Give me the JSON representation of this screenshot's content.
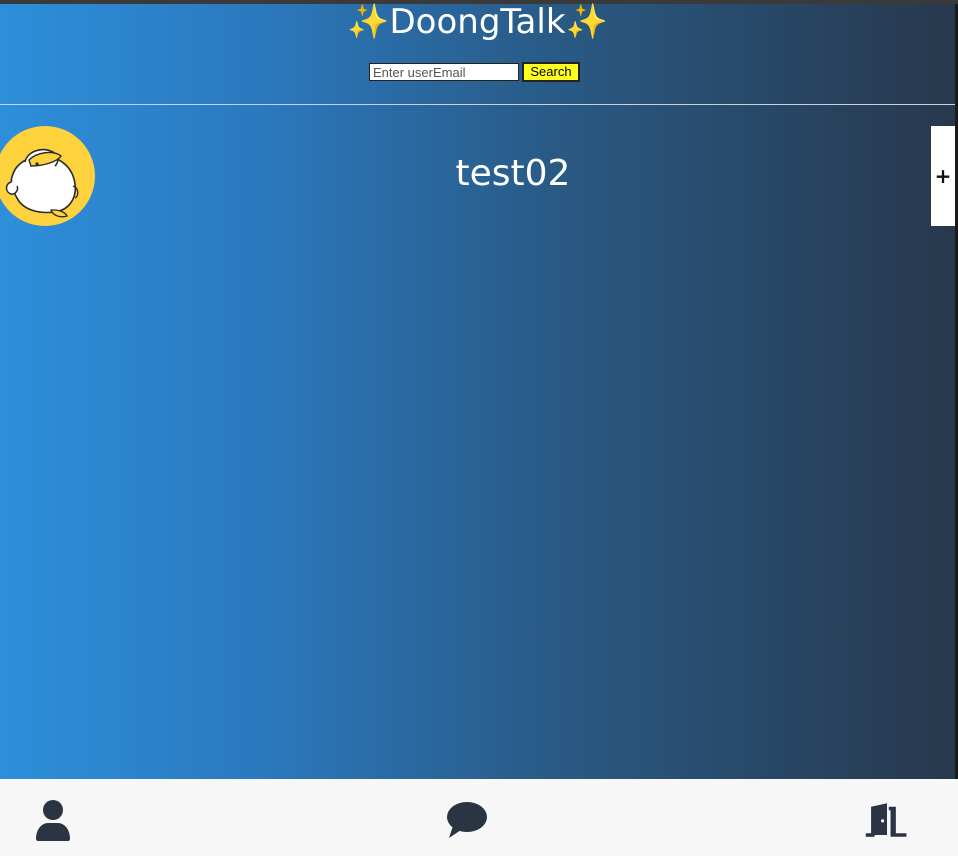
{
  "header": {
    "sparkle_left": "✨",
    "title": "DoongTalk",
    "sparkle_right": "✨"
  },
  "search": {
    "placeholder": "Enter userEmail",
    "value": "",
    "button_label": "Search"
  },
  "profile": {
    "username": "test02",
    "add_label": "+"
  },
  "bottom_nav": {
    "items": [
      {
        "icon": "user-icon"
      },
      {
        "icon": "chat-bubble-icon"
      },
      {
        "icon": "door-exit-icon"
      }
    ]
  },
  "colors": {
    "gradient_start": "#2d8fda",
    "gradient_end": "#28384d",
    "avatar_bg": "#fdd23d",
    "search_button_bg": "#ffff1f",
    "nav_bg": "#f7f7f7",
    "icon_color": "#2b3443"
  }
}
